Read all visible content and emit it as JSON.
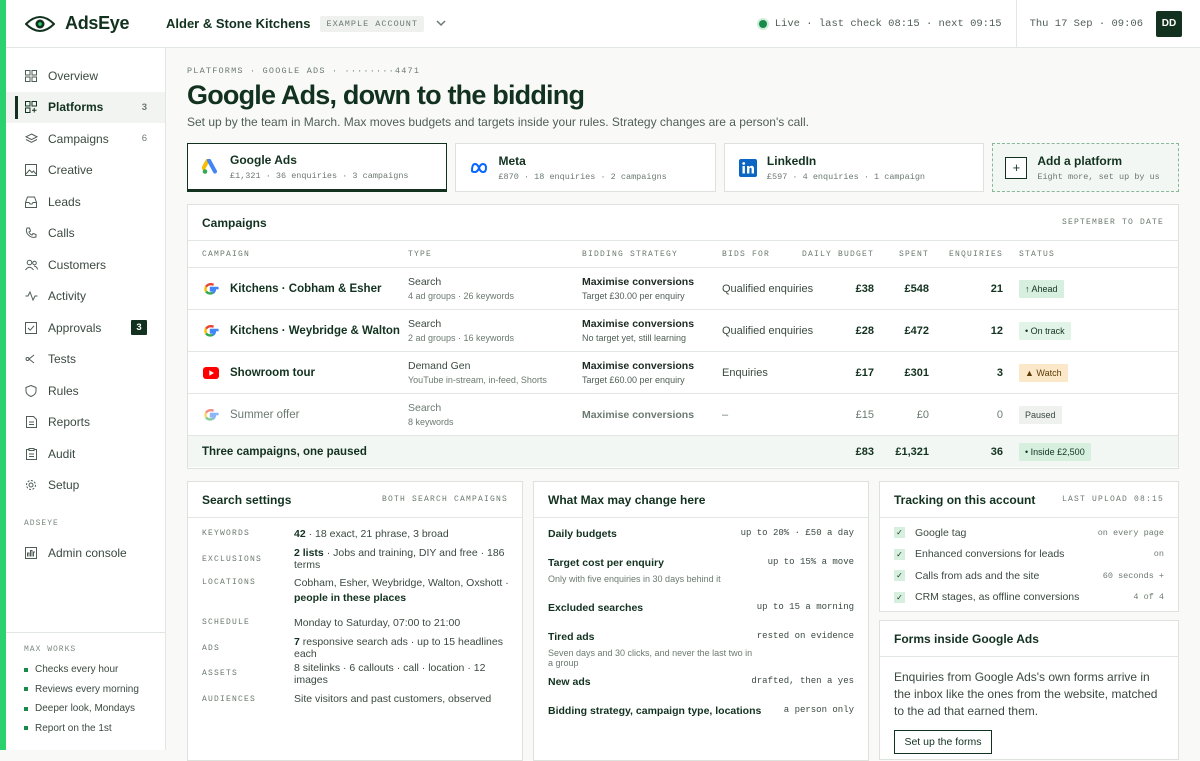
{
  "brand": {
    "name": "AdsEye",
    "accent": "#2ad16e",
    "dark": "#12321f"
  },
  "account": {
    "name": "Alder & Stone Kitchens",
    "badge": "EXAMPLE ACCOUNT"
  },
  "status": {
    "live": "Live · last check 08:15 · next 09:15",
    "date": "Thu 17 Sep · 09:06",
    "user_initials": "DD"
  },
  "sidebar": {
    "items": [
      {
        "label": "Overview",
        "icon": "grid-icon",
        "count": ""
      },
      {
        "label": "Platforms",
        "icon": "platforms-icon",
        "count": "3"
      },
      {
        "label": "Campaigns",
        "icon": "layers-icon",
        "count": "6"
      },
      {
        "label": "Creative",
        "icon": "image-icon",
        "count": ""
      },
      {
        "label": "Leads",
        "icon": "inbox-icon",
        "count": ""
      },
      {
        "label": "Calls",
        "icon": "phone-icon",
        "count": ""
      },
      {
        "label": "Customers",
        "icon": "users-icon",
        "count": ""
      },
      {
        "label": "Activity",
        "icon": "activity-icon",
        "count": ""
      },
      {
        "label": "Approvals",
        "icon": "check-square-icon",
        "count": "3"
      },
      {
        "label": "Tests",
        "icon": "split-icon",
        "count": ""
      },
      {
        "label": "Rules",
        "icon": "shield-icon",
        "count": ""
      },
      {
        "label": "Reports",
        "icon": "report-icon",
        "count": ""
      },
      {
        "label": "Audit",
        "icon": "clipboard-icon",
        "count": ""
      },
      {
        "label": "Setup",
        "icon": "gear-icon",
        "count": ""
      }
    ],
    "section_label": "ADSEYE",
    "admin_label": "Admin console",
    "max_works": {
      "heading": "MAX WORKS",
      "items": [
        "Checks every hour",
        "Reviews every morning",
        "Deeper look, Mondays",
        "Report on the 1st"
      ]
    }
  },
  "page": {
    "breadcrumb": "PLATFORMS · GOOGLE ADS · ········4471",
    "title": "Google Ads, down to the bidding",
    "subtitle": "Set up by the team in March. Max moves budgets and targets inside your rules. Strategy changes are a person's call."
  },
  "platforms": [
    {
      "name": "Google Ads",
      "meta": "£1,321 · 36 enquiries · 3 campaigns",
      "icon": "google-ads-icon"
    },
    {
      "name": "Meta",
      "meta": "£870 · 18 enquiries · 2 campaigns",
      "icon": "meta-icon"
    },
    {
      "name": "LinkedIn",
      "meta": "£597 · 4 enquiries · 1 campaign",
      "icon": "linkedin-icon"
    }
  ],
  "add_platform": {
    "title": "Add a platform",
    "meta": "Eight more, set up by us"
  },
  "campaigns": {
    "title": "Campaigns",
    "range": "SEPTEMBER TO DATE",
    "headers": [
      "CAMPAIGN",
      "TYPE",
      "BIDDING STRATEGY",
      "BIDS FOR",
      "DAILY BUDGET",
      "SPENT",
      "ENQUIRIES",
      "STATUS"
    ],
    "rows": [
      {
        "name": "Kitchens · Cobham & Esher",
        "icon": "google-icon",
        "type": "Search",
        "type_sub": "4 ad groups · 26 keywords",
        "bid": "Maximise conversions",
        "bid_sub": "Target £30.00 per enquiry",
        "bids_for": "Qualified enquiries",
        "budget": "£38",
        "spent": "£548",
        "enquiries": "21",
        "status": "↑ Ahead"
      },
      {
        "name": "Kitchens · Weybridge & Walton",
        "icon": "google-icon",
        "type": "Search",
        "type_sub": "2 ad groups · 16 keywords",
        "bid": "Maximise conversions",
        "bid_sub": "No target yet, still learning",
        "bids_for": "Qualified enquiries",
        "budget": "£28",
        "spent": "£472",
        "enquiries": "12",
        "status": "• On track"
      },
      {
        "name": "Showroom tour",
        "icon": "youtube-icon",
        "type": "Demand Gen",
        "type_sub": "YouTube in-stream, in-feed, Shorts",
        "bid": "Maximise conversions",
        "bid_sub": "Target £60.00 per enquiry",
        "bids_for": "Enquiries",
        "budget": "£17",
        "spent": "£301",
        "enquiries": "3",
        "status": "▲ Watch"
      },
      {
        "name": "Summer offer",
        "icon": "google-icon",
        "type": "Search",
        "type_sub": "8 keywords",
        "bid": "Maximise conversions",
        "bid_sub": "",
        "bids_for": "–",
        "budget": "£15",
        "spent": "£0",
        "enquiries": "0",
        "status": "Paused"
      }
    ],
    "total": {
      "label": "Three campaigns, one paused",
      "budget": "£83",
      "spent": "£1,321",
      "enquiries": "36",
      "status": "• Inside £2,500"
    }
  },
  "search_settings": {
    "title": "Search settings",
    "right": "BOTH SEARCH CAMPAIGNS",
    "rows": [
      {
        "k": "KEYWORDS",
        "b": "42",
        "v": " · 18 exact, 21 phrase, 3 broad"
      },
      {
        "k": "EXCLUSIONS",
        "b": "2 lists",
        "v": " · Jobs and training, DIY and free · 186 terms"
      },
      {
        "k": "LOCATIONS",
        "v": "Cobham, Esher, Weybridge, Walton, Oxshott · ",
        "b2": "people in these places"
      },
      {
        "k": "SCHEDULE",
        "v": "Monday to Saturday, 07:00 to 21:00"
      },
      {
        "k": "ADS",
        "b": "7",
        "v": " responsive search ads · up to 15 headlines each"
      },
      {
        "k": "ASSETS",
        "v": "8 sitelinks · 6 callouts · call · location · 12 images"
      },
      {
        "k": "AUDIENCES",
        "v": "Site visitors and past customers, observed"
      }
    ]
  },
  "max_changes": {
    "title": "What Max may change here",
    "rows": [
      {
        "label": "Daily budgets",
        "sub": "",
        "right": "up to 20% · £50 a day"
      },
      {
        "label": "Target cost per enquiry",
        "sub": "Only with five enquiries in 30 days behind it",
        "right": "up to 15% a move"
      },
      {
        "label": "Excluded searches",
        "sub": "",
        "right": "up to 15 a morning"
      },
      {
        "label": "Tired ads",
        "sub": "Seven days and 30 clicks, and never the last two in a group",
        "right": "rested on evidence"
      },
      {
        "label": "New ads",
        "sub": "",
        "right": "drafted, then a yes"
      },
      {
        "label": "Bidding strategy, campaign type, locations",
        "sub": "",
        "right": "a person only"
      }
    ]
  },
  "tracking": {
    "title": "Tracking on this account",
    "right": "LAST UPLOAD 08:15",
    "rows": [
      {
        "label": "Google tag",
        "right": "on every page"
      },
      {
        "label": "Enhanced conversions for leads",
        "right": "on"
      },
      {
        "label": "Calls from ads and the site",
        "right": "60 seconds +"
      },
      {
        "label": "CRM stages, as offline conversions",
        "right": "4 of 4"
      }
    ]
  },
  "forms": {
    "title": "Forms inside Google Ads",
    "body": "Enquiries from Google Ads's own forms arrive in the inbox like the ones from the website, matched to the ad that earned them.",
    "button": "Set up the forms"
  }
}
